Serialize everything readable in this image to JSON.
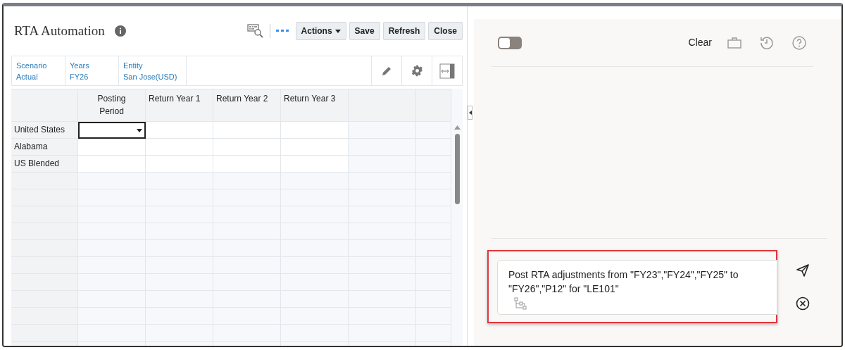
{
  "form": {
    "title": "RTA Automation",
    "toolbar_buttons": [
      "Actions",
      "Save",
      "Refresh",
      "Close"
    ],
    "pov": [
      {
        "label": "Scenario",
        "value": "Actual"
      },
      {
        "label": "Years",
        "value": "FY26"
      },
      {
        "label": "Entity",
        "value": "San Jose(USD)"
      }
    ],
    "grid": {
      "columns": [
        "Posting Period",
        "Return Year 1",
        "Return Year 2",
        "Return Year 3"
      ],
      "rows": [
        {
          "label": "United States",
          "selected": true
        },
        {
          "label": "Alabama",
          "selected": false
        },
        {
          "label": "US Blended",
          "selected": false
        }
      ]
    }
  },
  "assistant": {
    "toggle": {
      "on": false
    },
    "clear": "Clear",
    "prompt": {
      "value": "Post RTA adjustments from \"FY23\",\"FY24\",\"FY25\" to \"FY26\",\"P12\" for \"LE101\""
    }
  }
}
